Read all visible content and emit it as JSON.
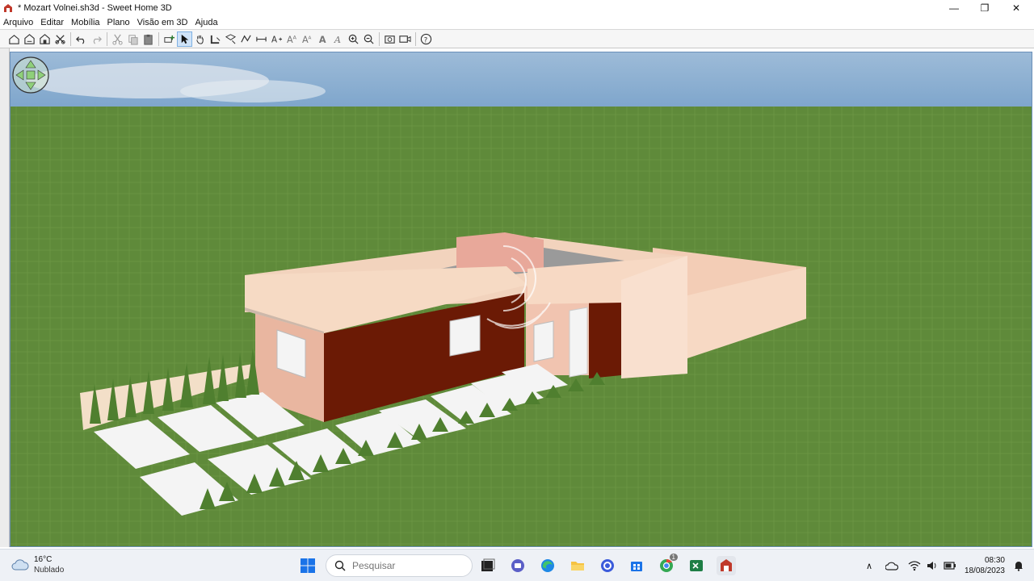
{
  "window": {
    "title": "* Mozart Volnei.sh3d - Sweet Home 3D",
    "minimize": "—",
    "maximize": "❐",
    "close": "✕"
  },
  "menu": {
    "items": [
      "Arquivo",
      "Editar",
      "Mobília",
      "Plano",
      "Visão em 3D",
      "Ajuda"
    ]
  },
  "toolbar": {
    "icons": [
      "new-home-icon",
      "open-icon",
      "save-icon",
      "cut-tool-icon",
      "undo-icon",
      "redo-icon",
      "cut-icon",
      "copy-icon",
      "paste-icon",
      "add-furniture-icon",
      "select-icon",
      "pan-icon",
      "create-walls-icon",
      "create-rooms-icon",
      "create-polylines-icon",
      "create-dimensions-icon",
      "add-text-icon",
      "increase-text-icon",
      "decrease-text-icon",
      "bold-text-icon",
      "italic-text-icon",
      "zoom-in-icon",
      "zoom-out-icon",
      "create-photo-icon",
      "create-video-icon",
      "help-icon"
    ]
  },
  "taskbar": {
    "weather": {
      "temp": "16°C",
      "condition": "Nublado"
    },
    "search_placeholder": "Pesquisar",
    "clock": {
      "time": "08:30",
      "date": "18/08/2023"
    },
    "chrome_badge": "1"
  },
  "colors": {
    "grass": "#5f8a3a",
    "sky": "#8fb4d6",
    "wall_brown": "#6b1a05",
    "wall_peach": "#f7d9c4",
    "wall_pink": "#e8b0a2",
    "accent_blue": "#1a73e8"
  }
}
